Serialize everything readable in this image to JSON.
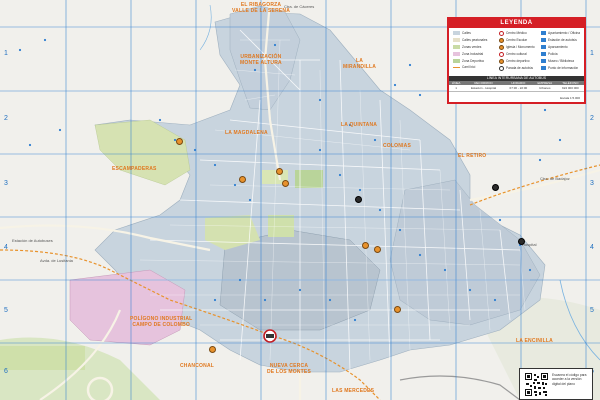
{
  "map": {
    "grid_numbers_left": [
      "1",
      "2",
      "3",
      "4",
      "5",
      "6",
      "7"
    ],
    "grid_numbers_right": [
      "1",
      "2",
      "3",
      "4",
      "5",
      "6",
      "7"
    ]
  },
  "districts": {
    "ribagorza": "EL RIBAGORZA\nVALLE DE LA SERENA",
    "monte_altura": "URBANIZACIÓN\nMONTE ALTURA",
    "la_mirandilla": "LA\nMIRANDILLA",
    "la_magdalena": "LA MAGDALENA",
    "la_quintana": "LA QUINTANA",
    "colonias": "COLONIAS",
    "el_retiro": "EL RETIRO",
    "escampaderas": "ESCAMPADERAS",
    "poligono": "POLÍGONO INDUSTRIAL\nCAMPO DE COLOMBO",
    "la_encinilla": "LA ENCINILLA",
    "nueva_cerca": "NUEVA CERCA\nDE LOS MONTES",
    "las_mercedes": "LAS MERCEDES",
    "chanconal": "CHANCONAL"
  },
  "small_labels": {
    "bus_station": "Estación de Autobuses",
    "road_w": "Avda. de Lusitania",
    "road_n": "Ctra. de Cáceres",
    "road_e": "Ctra. de Badajoz",
    "hospital": "Hospital"
  },
  "legend": {
    "title": "LEYENDA",
    "items_col1": [
      "Calles",
      "Calles peatonales",
      "Zonas verdes",
      "Zona Industrial",
      "Zona Deportiva",
      "Carril bici"
    ],
    "items_col2": [
      "Centro Médico",
      "Centro Escolar",
      "Iglesia / Monumento",
      "Centro cultural",
      "Centro deportivo",
      "Parada de autobús"
    ],
    "items_col3": [
      "Ayuntamiento / Oficina",
      "Estación de autobús",
      "Aparcamiento",
      "Policía",
      "Museo / Biblioteca",
      "Punto de información"
    ],
    "bus_section_title": "LÍNEA INTERURBANA DE AUTOBÚS",
    "bus_headers": [
      "LÍNEA",
      "RECORRIDO",
      "HORARIO",
      "EMPRESA",
      "TELÉFONO"
    ],
    "bus_rows": [
      [
        "1",
        "Estación - Hospital",
        "07:30 - 22:00",
        "Urbanos",
        "924 000 000"
      ]
    ],
    "scale": "Escala 1:5.000"
  },
  "qr": {
    "text": "Escanea el código para acceder a la versión digital del plano"
  },
  "colors": {
    "grid": "#2f7fd0",
    "legend_red": "#d51f26",
    "district_orange": "#e0781f",
    "industrial_pink": "#e6c3dd",
    "greens": "#c9dba5",
    "route": "#e8922c",
    "urban_blue": "#c8d4de"
  }
}
